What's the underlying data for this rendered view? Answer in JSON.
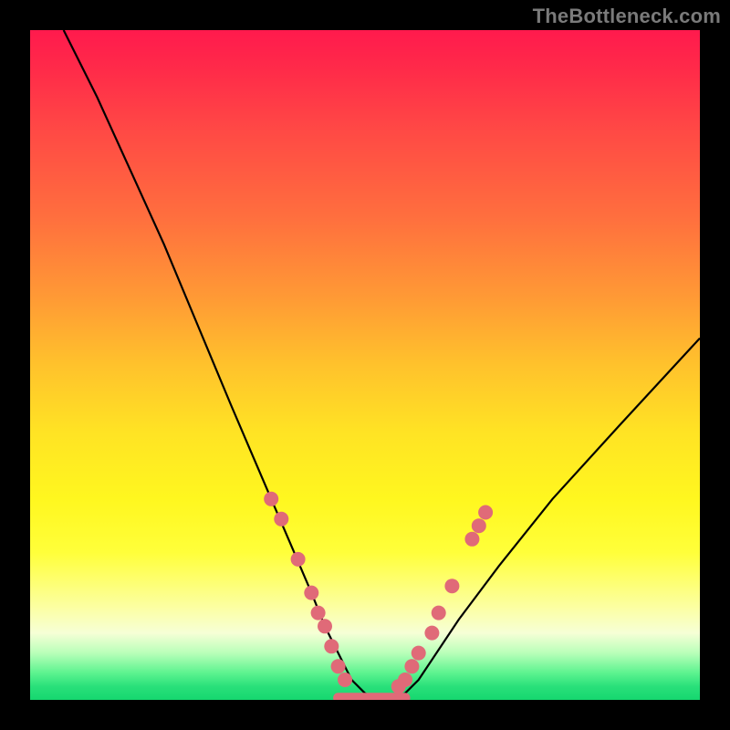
{
  "watermark": "TheBottleneck.com",
  "chart_data": {
    "type": "line",
    "title": "",
    "xlabel": "",
    "ylabel": "",
    "xlim": [
      0,
      100
    ],
    "ylim": [
      0,
      100
    ],
    "grid": false,
    "legend": "none",
    "series": [
      {
        "name": "bottleneck-curve",
        "x": [
          5,
          10,
          15,
          20,
          25,
          30,
          33,
          36,
          39,
          42,
          44,
          46,
          48,
          50,
          52,
          54,
          56,
          58,
          60,
          64,
          70,
          78,
          88,
          100
        ],
        "y": [
          100,
          90,
          79,
          68,
          56,
          44,
          37,
          30,
          23,
          16,
          11,
          7,
          3,
          1,
          0,
          0,
          1,
          3,
          6,
          12,
          20,
          30,
          41,
          54
        ]
      }
    ],
    "flat_region": {
      "x_start": 46,
      "x_end": 56,
      "y": 0
    },
    "dots_left": [
      {
        "x": 36,
        "y": 30
      },
      {
        "x": 37.5,
        "y": 27
      },
      {
        "x": 40,
        "y": 21
      },
      {
        "x": 42,
        "y": 16
      },
      {
        "x": 43,
        "y": 13
      },
      {
        "x": 44,
        "y": 11
      },
      {
        "x": 45,
        "y": 8
      },
      {
        "x": 46,
        "y": 5
      },
      {
        "x": 47,
        "y": 3
      }
    ],
    "dots_right": [
      {
        "x": 55,
        "y": 2
      },
      {
        "x": 56,
        "y": 3
      },
      {
        "x": 57,
        "y": 5
      },
      {
        "x": 58,
        "y": 7
      },
      {
        "x": 60,
        "y": 10
      },
      {
        "x": 61,
        "y": 13
      },
      {
        "x": 63,
        "y": 17
      },
      {
        "x": 66,
        "y": 24
      },
      {
        "x": 67,
        "y": 26
      },
      {
        "x": 68,
        "y": 28
      }
    ],
    "colors": {
      "curve": "#000000",
      "dots": "#e06a78",
      "gradient_top": "#ff1a4d",
      "gradient_mid": "#ffe324",
      "gradient_bottom": "#16d76f",
      "frame": "#000000"
    }
  }
}
